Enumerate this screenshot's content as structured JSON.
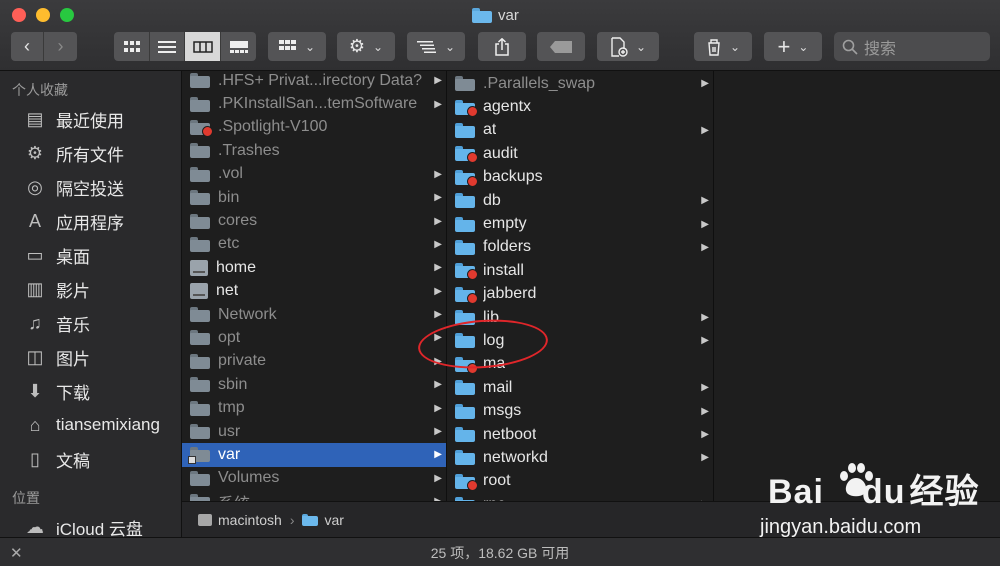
{
  "window": {
    "title": "var"
  },
  "toolbar": {
    "search_placeholder": "搜索"
  },
  "sidebar": {
    "favorites_header": "个人收藏",
    "favorites": [
      {
        "label": "最近使用",
        "icon": "recents-icon"
      },
      {
        "label": "所有文件",
        "icon": "all-files-gear-icon"
      },
      {
        "label": "隔空投送",
        "icon": "airdrop-icon"
      },
      {
        "label": "应用程序",
        "icon": "applications-icon"
      },
      {
        "label": "桌面",
        "icon": "desktop-icon"
      },
      {
        "label": "影片",
        "icon": "movies-icon"
      },
      {
        "label": "音乐",
        "icon": "music-icon"
      },
      {
        "label": "图片",
        "icon": "pictures-icon"
      },
      {
        "label": "下载",
        "icon": "downloads-icon"
      },
      {
        "label": "tiansemixiang",
        "icon": "home-icon"
      },
      {
        "label": "文稿",
        "icon": "documents-icon"
      }
    ],
    "locations_header": "位置",
    "locations": [
      {
        "label": "iCloud 云盘",
        "icon": "icloud-icon"
      }
    ]
  },
  "column1": [
    {
      "label": ".HFS+ Privat...irectory Data?",
      "style": "dim",
      "arrow": true
    },
    {
      "label": ".PKInstallSan...temSoftware",
      "style": "dim",
      "arrow": true
    },
    {
      "label": ".Spotlight-V100",
      "style": "dim-badge",
      "arrow": false
    },
    {
      "label": ".Trashes",
      "style": "dim",
      "arrow": false
    },
    {
      "label": ".vol",
      "style": "dim",
      "arrow": true
    },
    {
      "label": "bin",
      "style": "dim",
      "arrow": true
    },
    {
      "label": "cores",
      "style": "dim",
      "arrow": true
    },
    {
      "label": "etc",
      "style": "dim",
      "arrow": true
    },
    {
      "label": "home",
      "style": "disk",
      "arrow": true
    },
    {
      "label": "net",
      "style": "disk",
      "arrow": true
    },
    {
      "label": "Network",
      "style": "dim",
      "arrow": true
    },
    {
      "label": "opt",
      "style": "dim",
      "arrow": true
    },
    {
      "label": "private",
      "style": "dim",
      "arrow": true
    },
    {
      "label": "sbin",
      "style": "dim",
      "arrow": true
    },
    {
      "label": "tmp",
      "style": "dim",
      "arrow": true
    },
    {
      "label": "usr",
      "style": "dim",
      "arrow": true
    },
    {
      "label": "var",
      "style": "selected",
      "arrow": true
    },
    {
      "label": "Volumes",
      "style": "dim",
      "arrow": true
    },
    {
      "label": "系统",
      "style": "dim",
      "arrow": true
    }
  ],
  "column2": [
    {
      "label": ".Parallels_swap",
      "style": "dim",
      "arrow": true
    },
    {
      "label": "agentx",
      "style": "badge",
      "arrow": false
    },
    {
      "label": "at",
      "style": "normal",
      "arrow": true
    },
    {
      "label": "audit",
      "style": "badge",
      "arrow": false
    },
    {
      "label": "backups",
      "style": "badge",
      "arrow": false
    },
    {
      "label": "db",
      "style": "normal",
      "arrow": true
    },
    {
      "label": "empty",
      "style": "normal",
      "arrow": true
    },
    {
      "label": "folders",
      "style": "normal",
      "arrow": true
    },
    {
      "label": "install",
      "style": "badge",
      "arrow": false
    },
    {
      "label": "jabberd",
      "style": "badge",
      "arrow": false
    },
    {
      "label": "lib",
      "style": "normal",
      "arrow": true
    },
    {
      "label": "log",
      "style": "normal",
      "arrow": true
    },
    {
      "label": "ma",
      "style": "badge",
      "arrow": false
    },
    {
      "label": "mail",
      "style": "normal",
      "arrow": true
    },
    {
      "label": "msgs",
      "style": "normal",
      "arrow": true
    },
    {
      "label": "netboot",
      "style": "normal",
      "arrow": true
    },
    {
      "label": "networkd",
      "style": "normal",
      "arrow": true
    },
    {
      "label": "root",
      "style": "badge",
      "arrow": false
    },
    {
      "label": "rpc",
      "style": "normal",
      "arrow": true
    }
  ],
  "pathbar": {
    "disk": "macintosh",
    "folder": "var"
  },
  "status": {
    "text": "25 项，18.62 GB 可用"
  },
  "watermark": {
    "brand_latin": "Bai",
    "brand_latin2": "du",
    "brand_cn": "经验",
    "url": "jingyan.baidu.com"
  }
}
